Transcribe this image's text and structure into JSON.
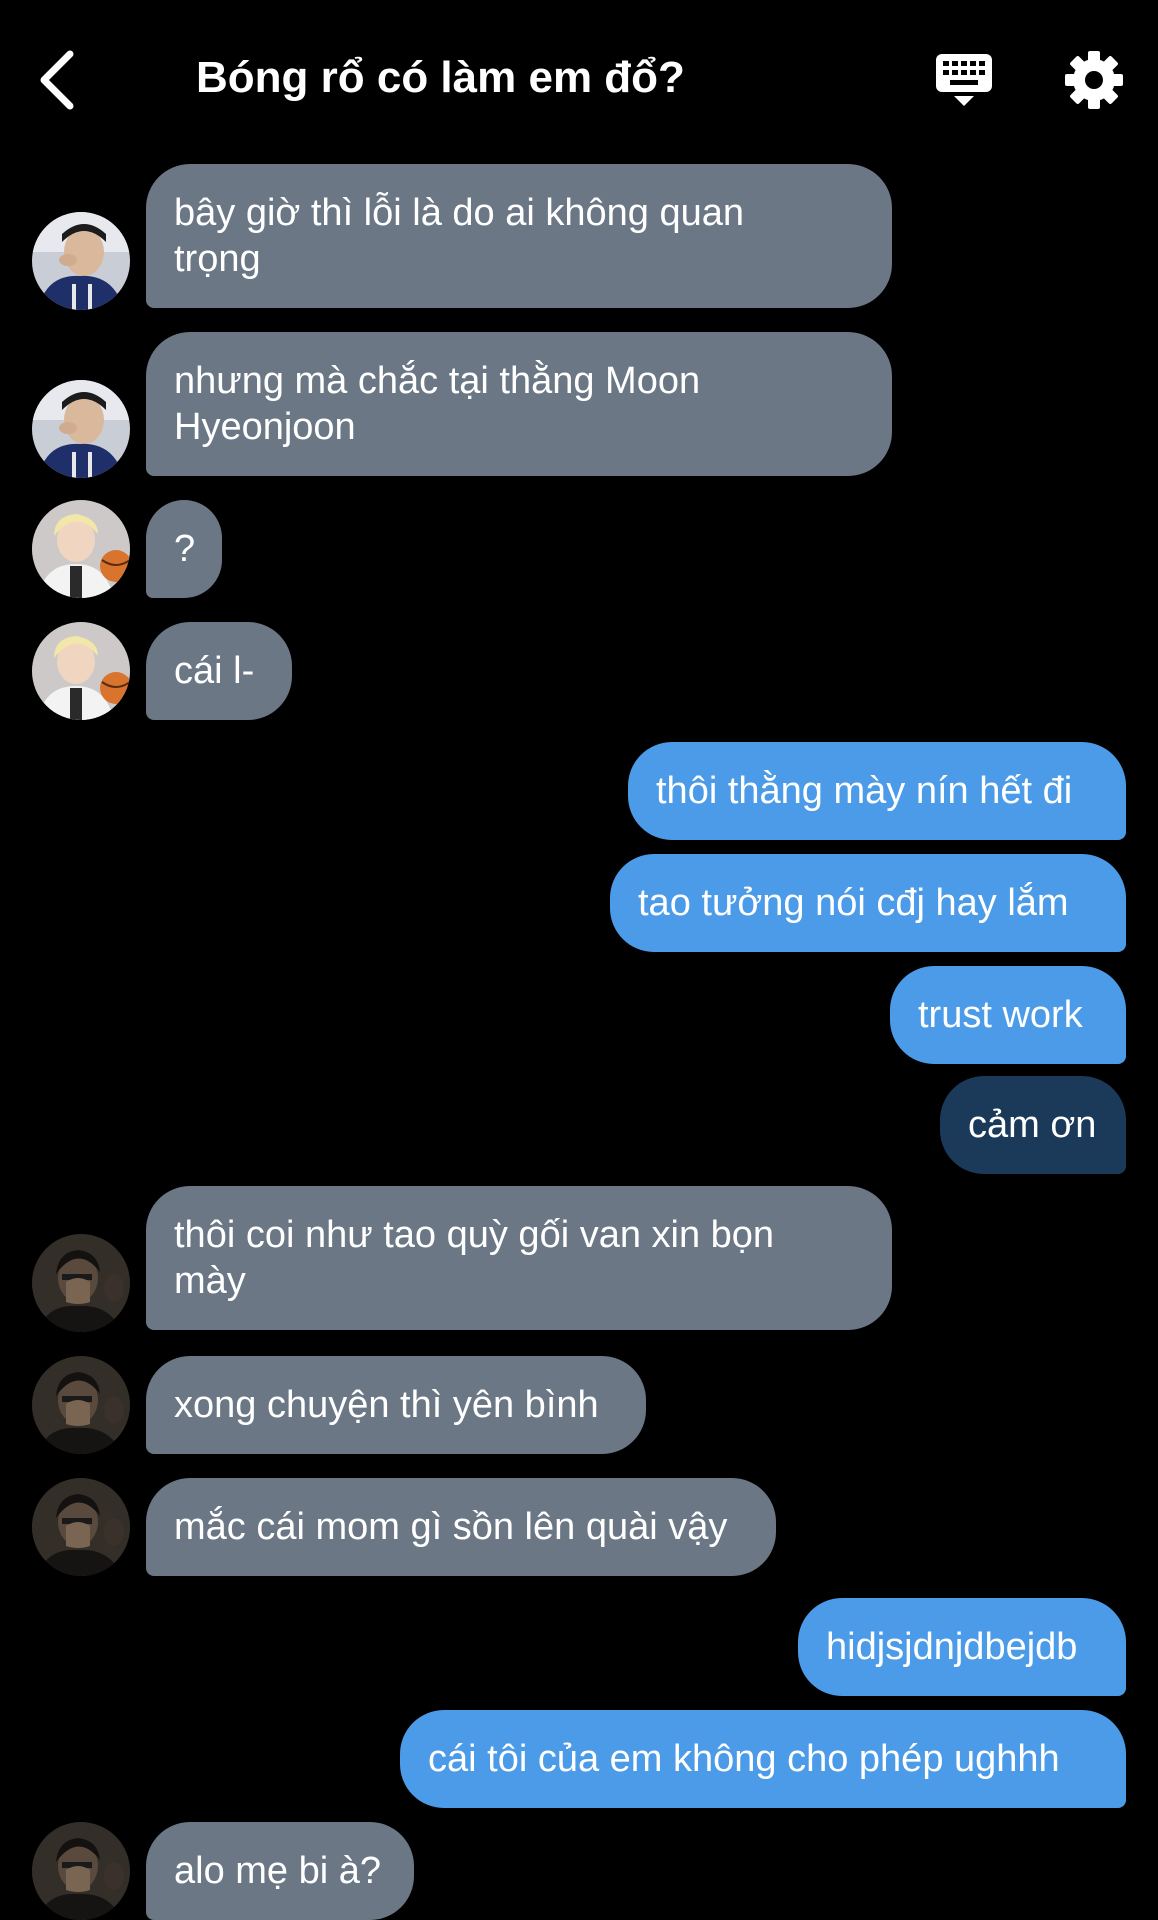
{
  "header": {
    "title": "Bóng rổ có làm em đổ?"
  },
  "colors": {
    "background": "#000000",
    "incoming_bubble": "#6b7785",
    "outgoing_bubble": "#4b9be8",
    "outgoing_bubble_selected": "#1b3a5a"
  },
  "icons": {
    "back": "chevron-left-icon",
    "keyboard": "keyboard-icon",
    "settings": "gear-icon"
  },
  "messages": [
    {
      "sender": "incoming",
      "avatar": "avatar-a",
      "text": "bây giờ thì lỗi là do ai không quan\ntrọng"
    },
    {
      "sender": "incoming",
      "avatar": "avatar-a",
      "text": "nhưng mà chắc tại thằng Moon\nHyeonjoon"
    },
    {
      "sender": "incoming",
      "avatar": "avatar-b",
      "text": "?"
    },
    {
      "sender": "incoming",
      "avatar": "avatar-b",
      "text": "cái l-"
    },
    {
      "sender": "outgoing",
      "text": "thôi thằng mày nín hết đi"
    },
    {
      "sender": "outgoing",
      "text": "tao tưởng nói cđj hay lắm"
    },
    {
      "sender": "outgoing",
      "text": "trust work"
    },
    {
      "sender": "outgoing",
      "text": "cảm ơn",
      "selected": true
    },
    {
      "sender": "incoming",
      "avatar": "avatar-c",
      "text": "thôi coi như tao quỳ gối van xin bọn\nmày"
    },
    {
      "sender": "incoming",
      "avatar": "avatar-c",
      "text": "xong chuyện thì yên bình"
    },
    {
      "sender": "incoming",
      "avatar": "avatar-c",
      "text": "mắc cái mom gì sồn lên quài vậy"
    },
    {
      "sender": "outgoing",
      "text": "hidjsjdnjdbejdb"
    },
    {
      "sender": "outgoing",
      "text": "cái tôi của em không cho phép ughhh"
    },
    {
      "sender": "incoming",
      "avatar": "avatar-c",
      "text": "alo mẹ bi à?"
    }
  ]
}
